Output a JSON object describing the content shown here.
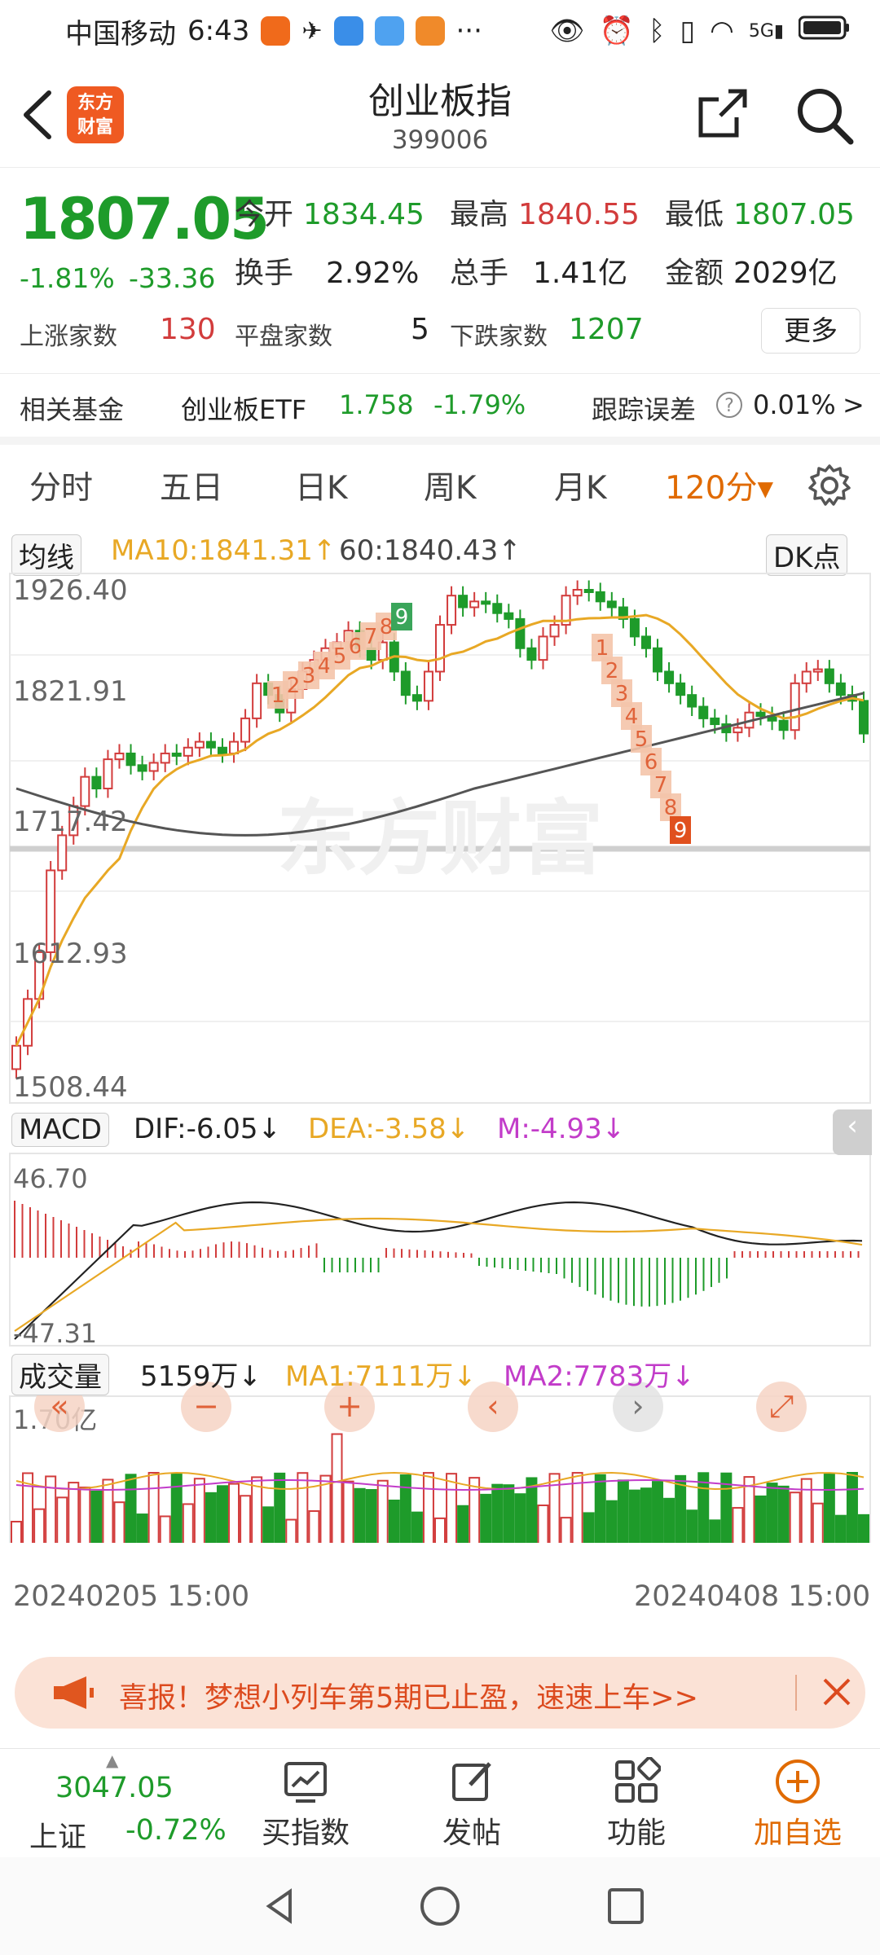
{
  "status_bar": {
    "carrier": "中国移动",
    "time": "6:43",
    "dots": "···"
  },
  "header": {
    "logo_text": "东方\n财富",
    "title": "创业板指",
    "code": "399006"
  },
  "quote": {
    "price": "1807.05",
    "change_pct": "-1.81%",
    "change": "-33.36",
    "open_label": "今开",
    "open": "1834.45",
    "high_label": "最高",
    "high": "1840.55",
    "low_label": "最低",
    "low": "1807.05",
    "turnover_label": "换手",
    "turnover": "2.92%",
    "volume_label": "总手",
    "volume": "1.41亿",
    "amount_label": "金额",
    "amount": "2029亿",
    "up_label": "上涨家数",
    "up": "130",
    "flat_label": "平盘家数",
    "flat": "5",
    "down_label": "下跌家数",
    "down": "1207",
    "more_label": "更多"
  },
  "fund": {
    "label": "相关基金",
    "name": "创业板ETF",
    "price": "1.758",
    "pct": "-1.79%",
    "tracking_label": "跟踪误差",
    "tracking": "0.01%",
    "arrow": ">"
  },
  "tabs": [
    {
      "label": "分时"
    },
    {
      "label": "五日"
    },
    {
      "label": "日K"
    },
    {
      "label": "周K"
    },
    {
      "label": "月K"
    },
    {
      "label": "120分▾"
    }
  ],
  "kline": {
    "ma_select": "均线",
    "ma10": "MA10:1841.31↑",
    "ma60": "60:1840.43↑",
    "dk_select": "DK点",
    "y_labels": [
      "1926.40",
      "1821.91",
      "1717.42",
      "1612.93",
      "1508.44"
    ],
    "watermark": "东方财富",
    "signals_up": [
      "1",
      "2",
      "3",
      "4",
      "5",
      "6",
      "7",
      "8",
      "9"
    ],
    "signals_down": [
      "1",
      "2",
      "3",
      "4",
      "5",
      "6",
      "7",
      "8",
      "9"
    ]
  },
  "nav_buttons": [
    "«",
    "−",
    "+",
    "‹",
    "›",
    "⤢"
  ],
  "macd": {
    "select": "MACD",
    "dif": "DIF:-6.05↓",
    "dea": "DEA:-3.58↓",
    "m": "M:-4.93↓",
    "y_top": "46.70",
    "y_bottom": "-47.31"
  },
  "volume": {
    "select": "成交量",
    "value": "5159万↓",
    "ma1": "MA1:7111万↓",
    "ma2": "MA2:7783万↓",
    "y_top": "1.70亿"
  },
  "dates": {
    "start": "20240205 15:00",
    "end": "20240408 15:00"
  },
  "banner": {
    "text": "喜报！梦想小列车第5期已止盈，速速上车>>"
  },
  "bottom_bar": {
    "index_value": "3047.05",
    "index_name": "上证",
    "index_pct": "-0.72%",
    "items": [
      "买指数",
      "发帖",
      "功能",
      "加自选"
    ]
  },
  "colors": {
    "up": "#d23c3c",
    "down": "#1e9b2a",
    "accent": "#e06a00",
    "ma10": "#e8a825",
    "ma60": "#555555"
  }
}
